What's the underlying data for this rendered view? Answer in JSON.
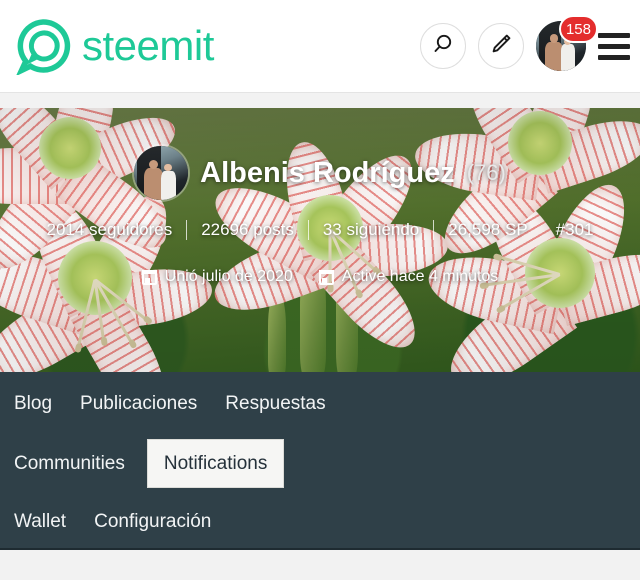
{
  "brand": {
    "name": "steemit",
    "logo_icon": "steemit-speech-bubble-logo",
    "color": "#1ec997"
  },
  "header": {
    "search_icon": "search-icon",
    "compose_icon": "pencil-edit-icon",
    "avatar_icon": "user-avatar",
    "notification_count": "158",
    "notification_badge_color": "#e42d2d",
    "menu_icon": "hamburger-menu-icon"
  },
  "profile": {
    "display_name": "Albenis Rodríguez",
    "reputation": "(76)",
    "avatar_icon": "profile-avatar",
    "stats": [
      {
        "label": "2014 seguidores"
      },
      {
        "label": "22696 posts"
      },
      {
        "label": "33 siguiendo"
      },
      {
        "label": "26,598 SP"
      },
      {
        "label": "#301"
      }
    ],
    "meta": [
      {
        "icon": "calendar-icon",
        "label": "Unió julio de 2020"
      },
      {
        "icon": "calendar-icon",
        "label": "Active hace 4 minutos"
      }
    ]
  },
  "nav": {
    "background_color": "#2f4048",
    "active_tab": "Notifications",
    "rows": [
      [
        {
          "label": "Blog",
          "active": false
        },
        {
          "label": "Publicaciones",
          "active": false
        },
        {
          "label": "Respuestas",
          "active": false
        }
      ],
      [
        {
          "label": "Communities",
          "active": false
        },
        {
          "label": "Notifications",
          "active": true
        }
      ],
      [
        {
          "label": "Wallet",
          "active": false
        },
        {
          "label": "Configuración",
          "active": false
        }
      ]
    ]
  }
}
